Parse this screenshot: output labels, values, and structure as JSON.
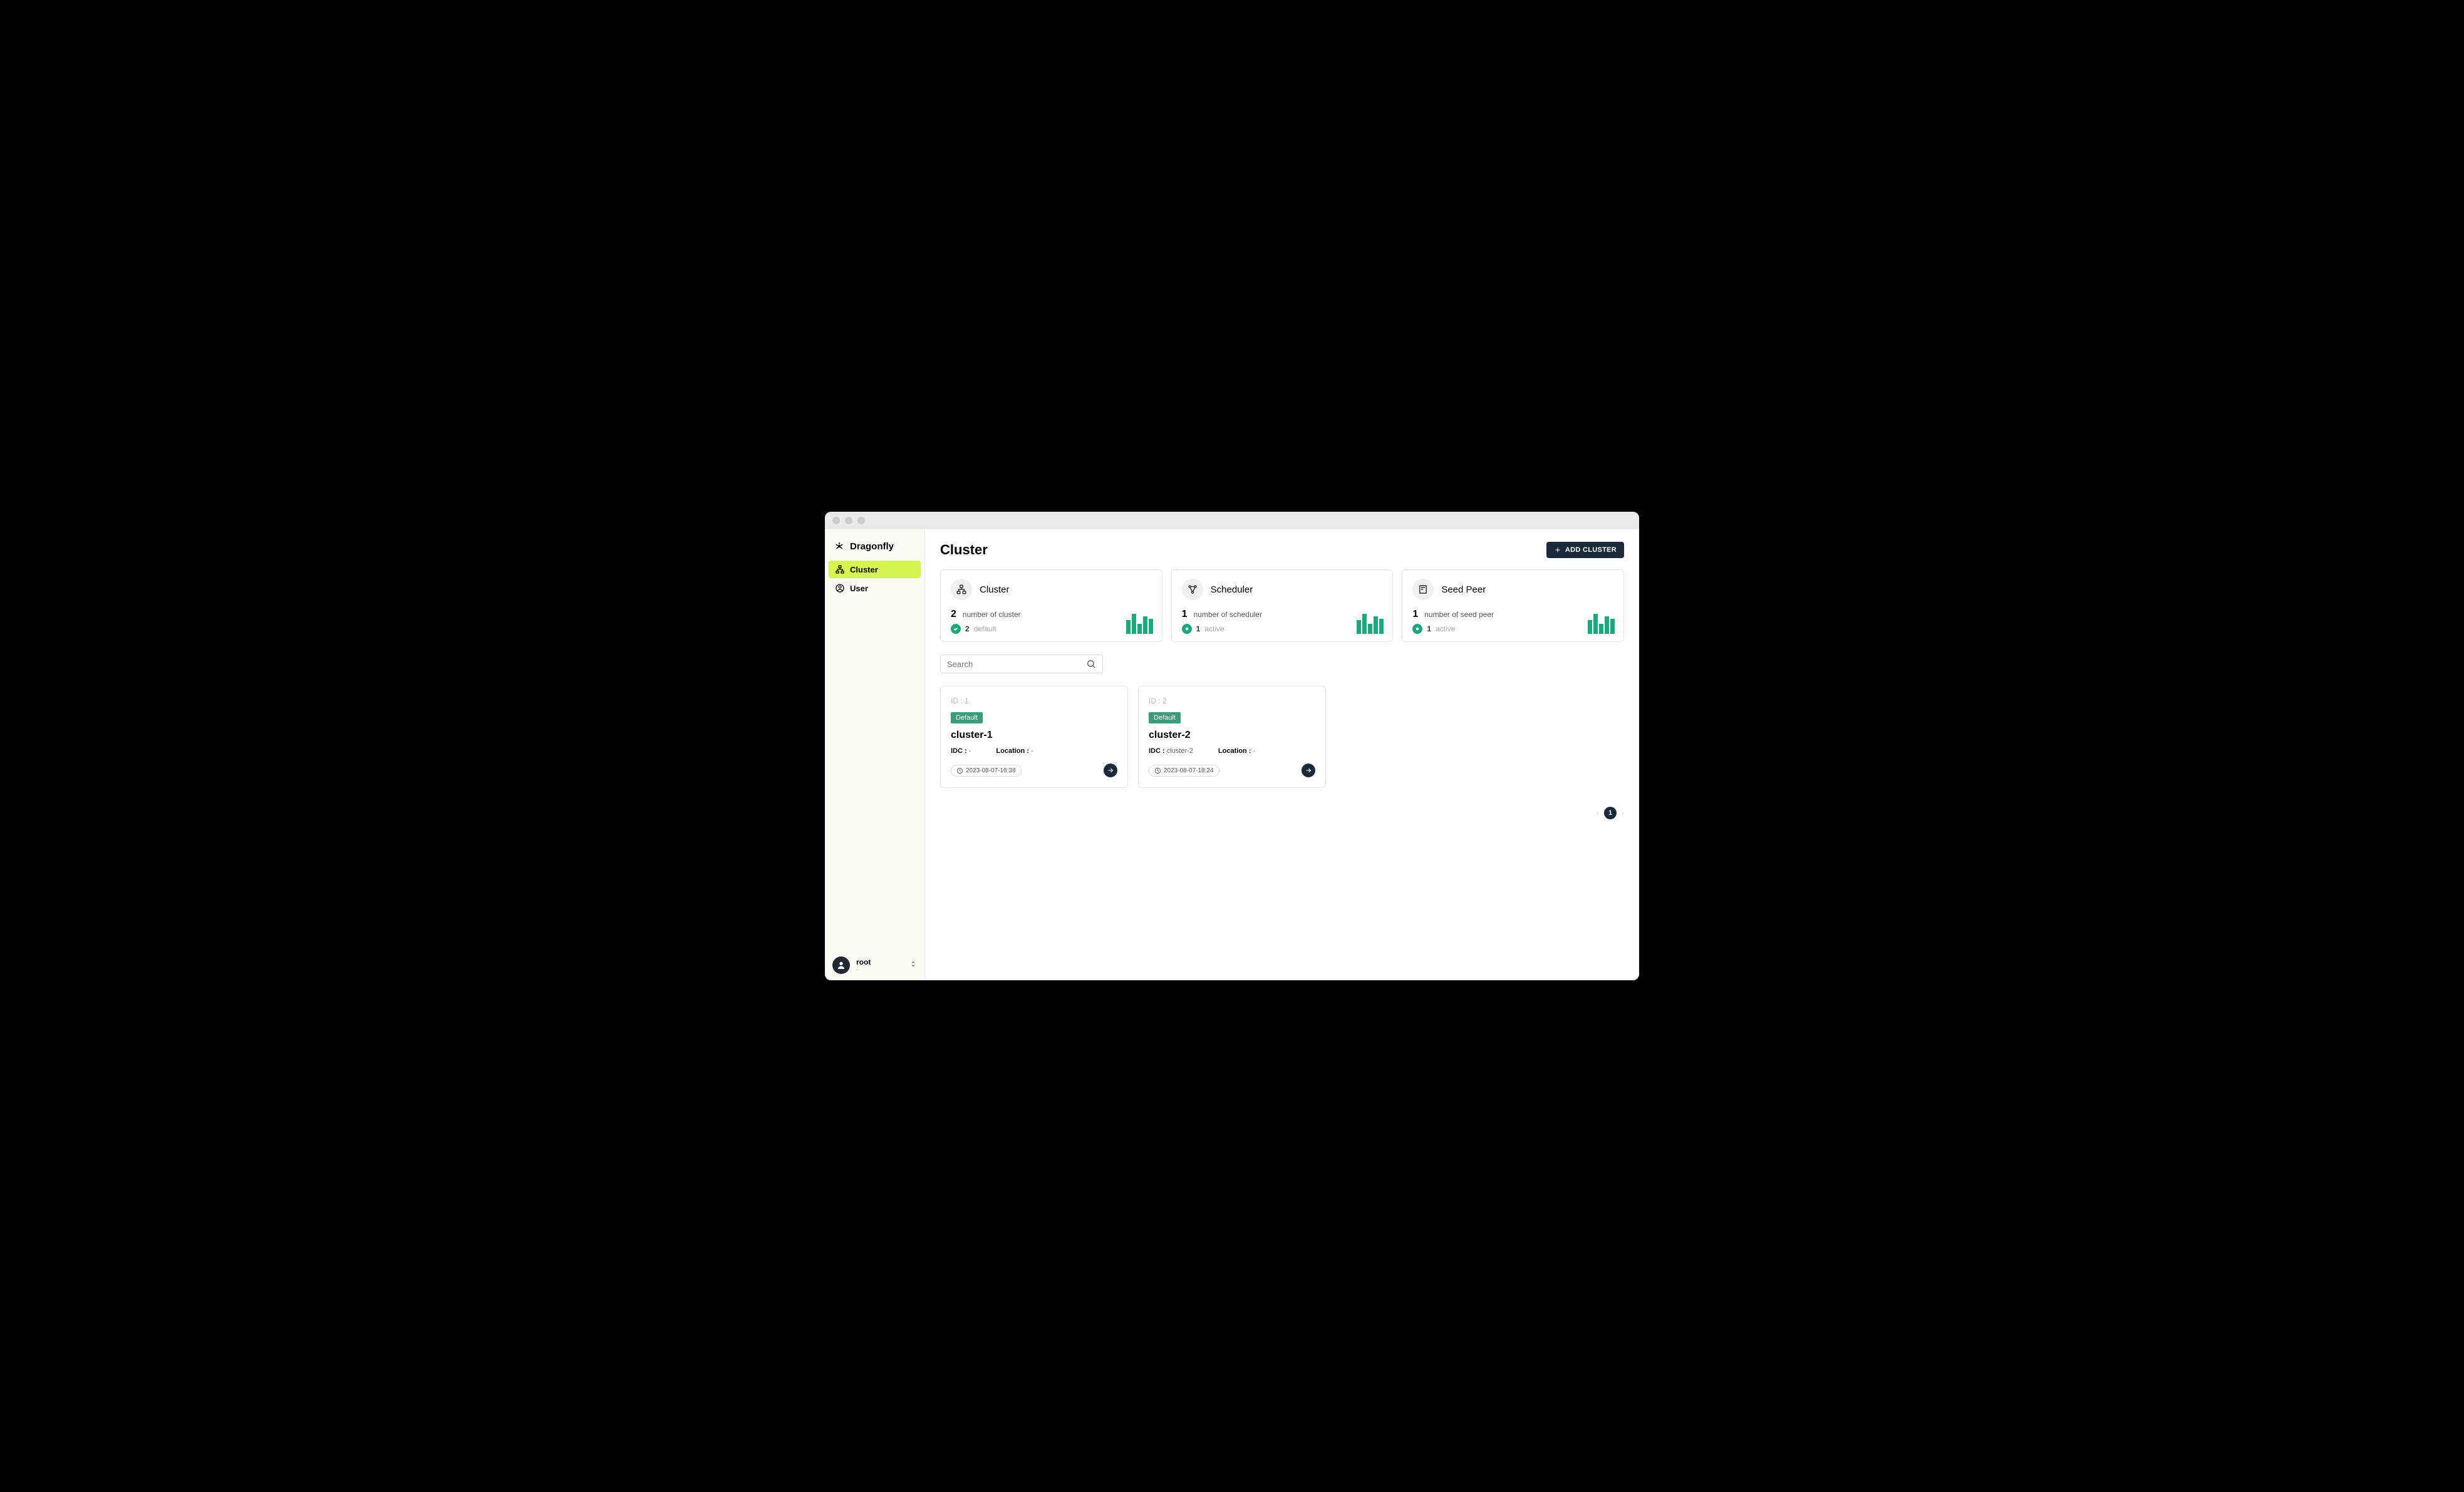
{
  "brand": "Dragonfly",
  "nav": {
    "cluster": "Cluster",
    "user": "User"
  },
  "user": {
    "name": "root",
    "sub": "-"
  },
  "header": {
    "title": "Cluster",
    "add_button": "ADD CLUSTER"
  },
  "stats": {
    "cluster": {
      "title": "Cluster",
      "count": "2",
      "count_label": "number of cluster",
      "sub_count": "2",
      "sub_label": "default"
    },
    "scheduler": {
      "title": "Scheduler",
      "count": "1",
      "count_label": "number of scheduler",
      "sub_count": "1",
      "sub_label": "active"
    },
    "seedpeer": {
      "title": "Seed Peer",
      "count": "1",
      "count_label": "number of seed peer",
      "sub_count": "1",
      "sub_label": "active"
    }
  },
  "search": {
    "placeholder": "Search"
  },
  "clusters": [
    {
      "id_label": "ID : 1",
      "badge": "Default",
      "name": "cluster-1",
      "idc_label": "IDC :",
      "idc_value": "-",
      "loc_label": "Location :",
      "loc_value": "-",
      "time": "2023-08-07-16:38"
    },
    {
      "id_label": "ID : 2",
      "badge": "Default",
      "name": "cluster-2",
      "idc_label": "IDC :",
      "idc_value": "cluster-2",
      "loc_label": "Location :",
      "loc_value": "-",
      "time": "2023-08-07-18:24"
    }
  ],
  "pager": {
    "current": "1"
  }
}
